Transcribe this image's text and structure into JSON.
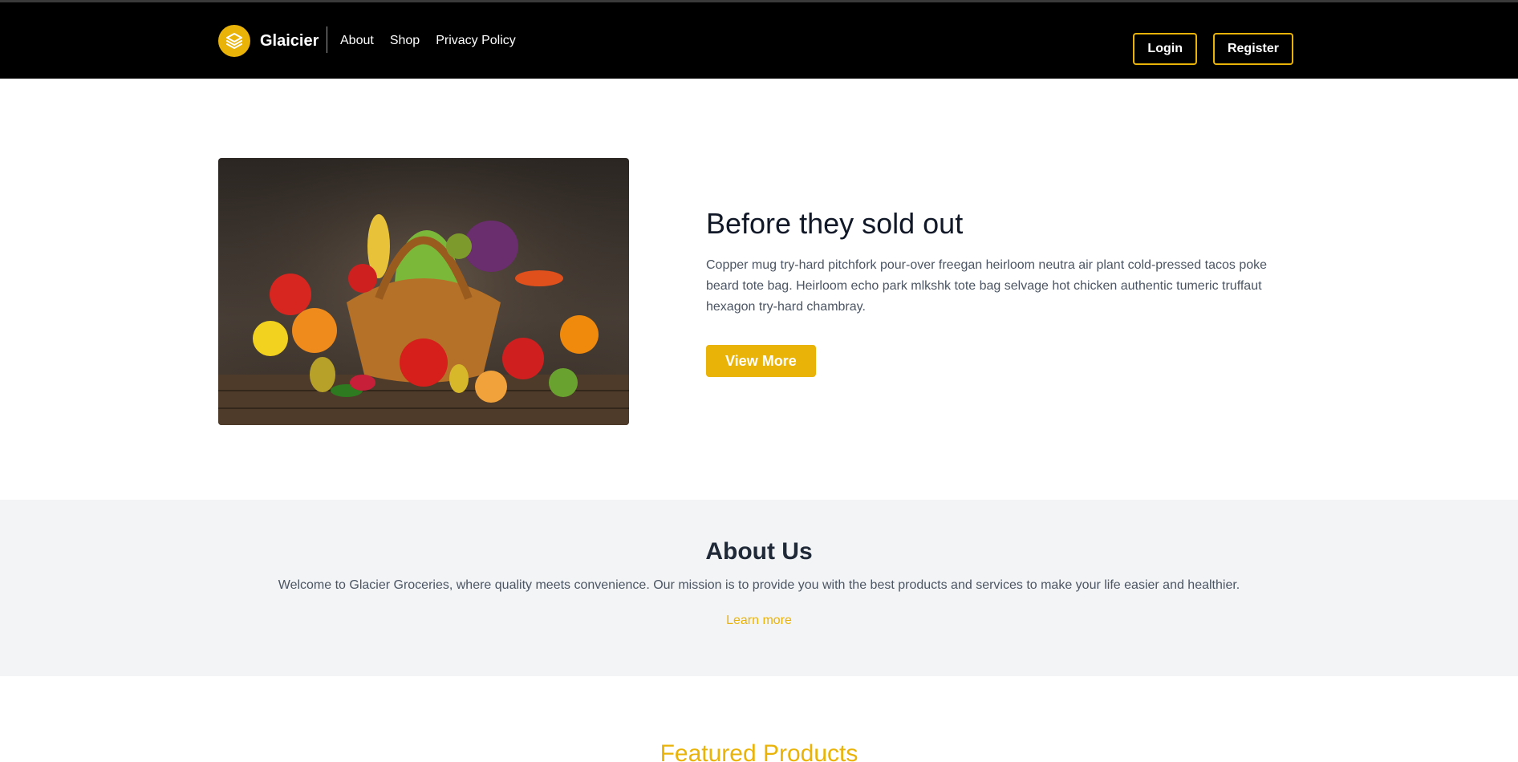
{
  "header": {
    "brand_name": "Glaicier",
    "logo_icon": "stack-layers-icon",
    "nav": [
      "About",
      "Shop",
      "Privacy Policy"
    ],
    "login_label": "Login",
    "register_label": "Register",
    "background_color": "#000000",
    "accent_color": "#eab308"
  },
  "hero": {
    "image": "vegetable-basket-photo",
    "title": "Before they sold out",
    "description": "Copper mug try-hard pitchfork pour-over freegan heirloom neutra air plant cold-pressed tacos poke beard tote bag. Heirloom echo park mlkshk tote bag selvage hot chicken authentic tumeric truffaut hexagon try-hard chambray.",
    "button_label": "View More"
  },
  "about": {
    "title": "About Us",
    "text": "Welcome to Glacier Groceries, where quality meets convenience. Our mission is to provide you with the best products and services to make your life easier and healthier.",
    "link_label": "Learn more"
  },
  "featured": {
    "title": "Featured Products"
  }
}
